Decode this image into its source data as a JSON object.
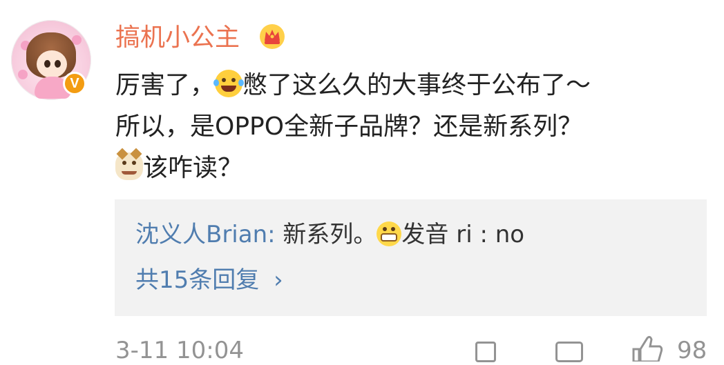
{
  "comment": {
    "username": "搞机小公主",
    "verified_badge": "V",
    "text_line1_a": "厉害了，",
    "text_line1_b": "憋了这么久的大事终于公布了～",
    "text_line2": "所以，是OPPO全新子品牌？还是新系列？",
    "text_line3": "该咋读？",
    "emoji_1": "laughing-tears-emoji",
    "emoji_2": "cat-emoji"
  },
  "reply": {
    "user": "沈义人Brian",
    "separator": ":",
    "text_a": " 新系列。",
    "text_b": "发音 ri : no",
    "emoji": "grin-emoji",
    "count_label": "共15条回复",
    "chevron": "›"
  },
  "footer": {
    "timestamp": "3-11 10:04",
    "like_count": "98",
    "icons": [
      "share-icon",
      "comment-icon",
      "like-icon"
    ]
  },
  "colors": {
    "username": "#eb7350",
    "link": "#507daf",
    "reply_bg": "#f2f2f2",
    "meta": "#939393"
  }
}
